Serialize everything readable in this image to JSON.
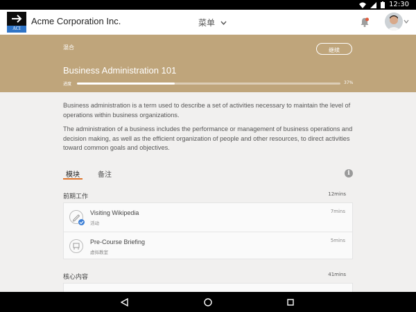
{
  "status": {
    "time": "12:30"
  },
  "header": {
    "logo_text": "ACI",
    "company": "Acme Corporation Inc.",
    "menu_label": "菜单"
  },
  "hero": {
    "mode": "混合",
    "continue_label": "继续",
    "course_title": "Business Administration 101",
    "progress_label": "进度",
    "progress_percent": 37,
    "progress_text": "37%"
  },
  "description": {
    "p1": "Business administration is a term used to describe a set of activities necessary to maintain the level of operations within business organizations.",
    "p2": "The administration of a business includes the performance or management of business operations and decision making, as well as the efficient organization of people and other resources, to direct activities toward common goals and objectives."
  },
  "tabs": [
    {
      "label": "模块",
      "active": true
    },
    {
      "label": "备注",
      "active": false
    }
  ],
  "sections": [
    {
      "title": "前期工作",
      "duration": "12mins",
      "items": [
        {
          "title": "Visiting Wikipedia",
          "subtitle": "活动",
          "duration": "7mins",
          "icon": "pencil-check-icon"
        },
        {
          "title": "Pre-Course Briefing",
          "subtitle": "虚拟教室",
          "duration": "5mins",
          "icon": "classroom-icon"
        }
      ]
    },
    {
      "title": "核心内容",
      "duration": "41mins"
    }
  ],
  "colors": {
    "hero": "#bfa57b",
    "tab_underline": "#e0752b",
    "logo_band": "#2f74c6"
  }
}
